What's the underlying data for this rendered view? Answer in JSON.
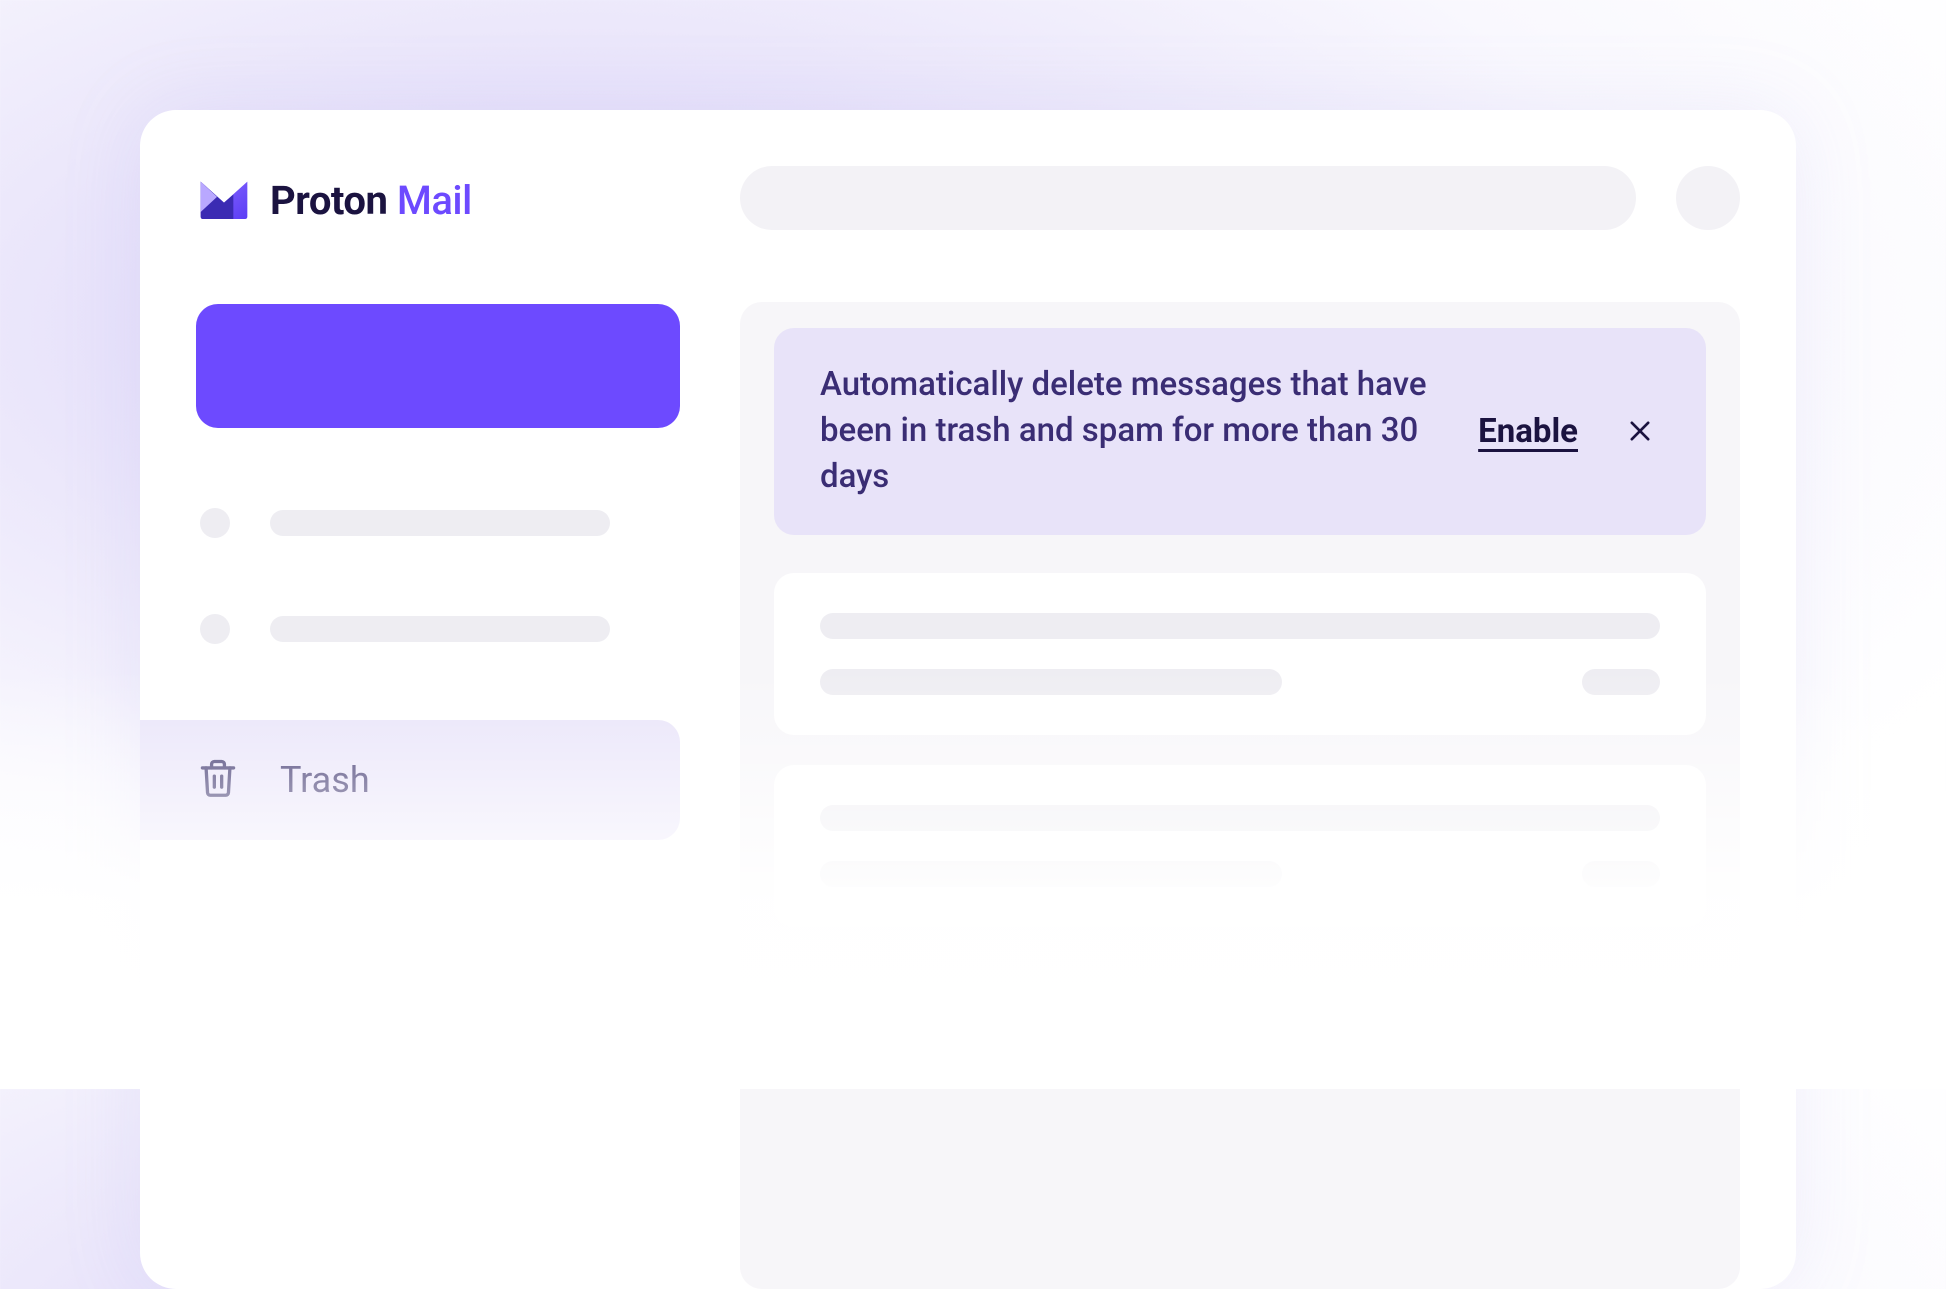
{
  "brand": {
    "name": "Proton",
    "product": "Mail"
  },
  "sidebar": {
    "active": {
      "label": "Trash"
    }
  },
  "banner": {
    "message": "Automatically delete messages that have been in trash and spam for more than 30 days",
    "action_label": "Enable"
  }
}
